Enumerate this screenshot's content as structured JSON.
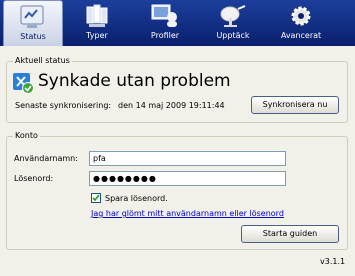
{
  "tabs": [
    {
      "label": "Status",
      "icon": "status-icon",
      "active": true
    },
    {
      "label": "Typer",
      "icon": "file-types-icon",
      "active": false
    },
    {
      "label": "Profiler",
      "icon": "profiles-icon",
      "active": false
    },
    {
      "label": "Upptäck",
      "icon": "discover-icon",
      "active": false
    },
    {
      "label": "Avancerat",
      "icon": "gear-icon",
      "active": false
    }
  ],
  "status": {
    "group_title": "Aktuell status",
    "headline": "Synkade utan problem",
    "last_sync_label": "Senaste synkronisering:",
    "last_sync_value": "den 14 maj 2009 19:11:44",
    "sync_button": "Synkronisera nu"
  },
  "account": {
    "group_title": "Konto",
    "username_label": "Användarnamn:",
    "username_value": "pfa",
    "password_label": "Lösenord:",
    "password_value": "●●●●●●●●",
    "save_password_label": "Spara lösenord.",
    "save_password_checked": true,
    "forgot_link": "Jag har glömt mitt användarnamn eller lösenord",
    "wizard_button": "Starta guiden"
  },
  "version": "v3.1.1",
  "colors": {
    "toolbar": "#0a1f6d",
    "link": "#0000cc",
    "success": "#3aa63a"
  }
}
